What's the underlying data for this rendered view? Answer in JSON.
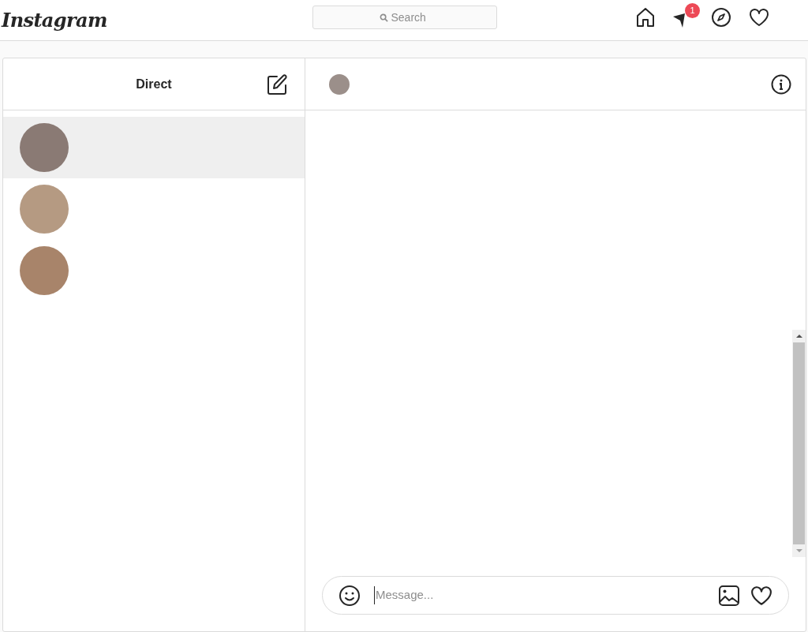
{
  "logo": "Instagram",
  "search": {
    "placeholder": "Search"
  },
  "nav": {
    "notification_count": "1"
  },
  "inbox": {
    "title": "Direct",
    "conversations": [
      {
        "selected": true
      },
      {
        "selected": false
      },
      {
        "selected": false
      }
    ]
  },
  "composer": {
    "placeholder": "Message..."
  }
}
